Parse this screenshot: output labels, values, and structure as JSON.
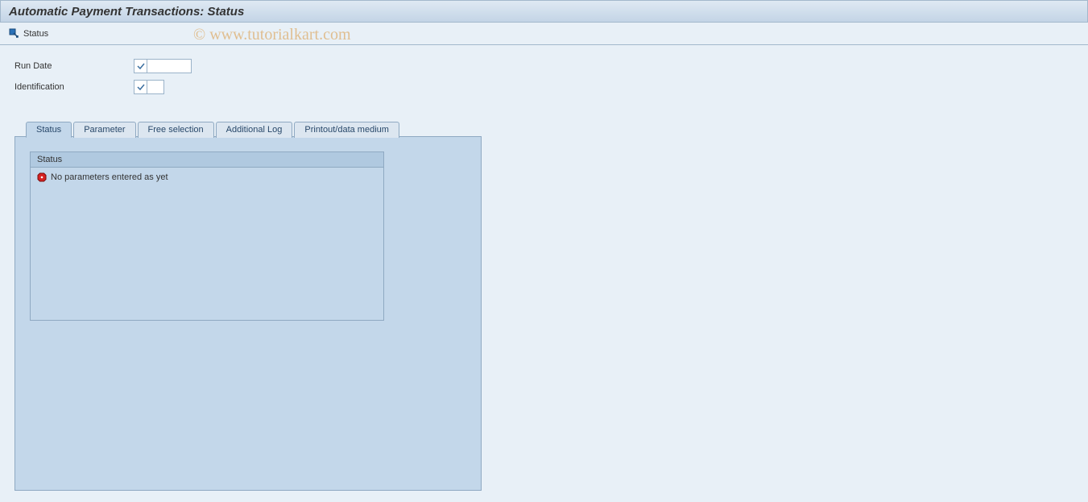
{
  "title": "Automatic Payment Transactions: Status",
  "toolbar": {
    "status_label": "Status"
  },
  "fields": {
    "run_date": {
      "label": "Run Date",
      "value": ""
    },
    "identification": {
      "label": "Identification",
      "value": ""
    }
  },
  "tabs": [
    {
      "label": "Status",
      "active": true
    },
    {
      "label": "Parameter",
      "active": false
    },
    {
      "label": "Free selection",
      "active": false
    },
    {
      "label": "Additional Log",
      "active": false
    },
    {
      "label": "Printout/data medium",
      "active": false
    }
  ],
  "status_panel": {
    "header": "Status",
    "message": "No parameters entered as yet"
  },
  "watermark": "© www.tutorialkart.com"
}
